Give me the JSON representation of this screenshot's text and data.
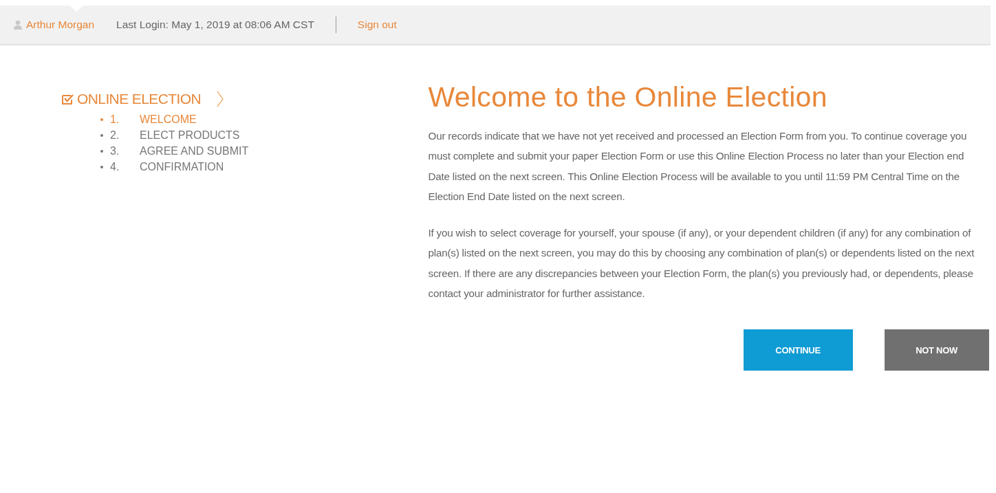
{
  "header": {
    "user_name": "Arthur Morgan",
    "last_login": "Last Login: May 1, 2019 at 08:06 AM CST",
    "sign_out": "Sign out"
  },
  "sidebar": {
    "title": "ONLINE ELECTION",
    "steps": [
      {
        "number": "1.",
        "label": "WELCOME",
        "selected": true
      },
      {
        "number": "2.",
        "label": "ELECT PRODUCTS",
        "selected": false
      },
      {
        "number": "3.",
        "label": "AGREE AND SUBMIT",
        "selected": false
      },
      {
        "number": "4.",
        "label": "CONFIRMATION",
        "selected": false
      }
    ]
  },
  "main": {
    "title": "Welcome to the Online Election",
    "paragraphs": [
      "Our records indicate that we have not yet received and processed an Election Form from you. To continue coverage you must complete and submit your paper Election Form or use this Online Election Process no later than your Election end Date listed on the next screen. This Online Election Process will be available to you until 11:59 PM Central Time on the Election End Date listed on the next screen.",
      "If you wish to select coverage for yourself, your spouse (if any), or your dependent children (if any) for any combination of plan(s) listed on the next screen, you may do this by choosing any combination of plan(s) or dependents listed on the next screen. If there are any discrepancies between your Election Form, the plan(s) you previously had, or dependents, please contact your administrator for further assistance."
    ],
    "buttons": [
      {
        "label": "CONTINUE",
        "kind": "primary"
      },
      {
        "label": "NOT NOW",
        "kind": "secondary"
      }
    ]
  }
}
